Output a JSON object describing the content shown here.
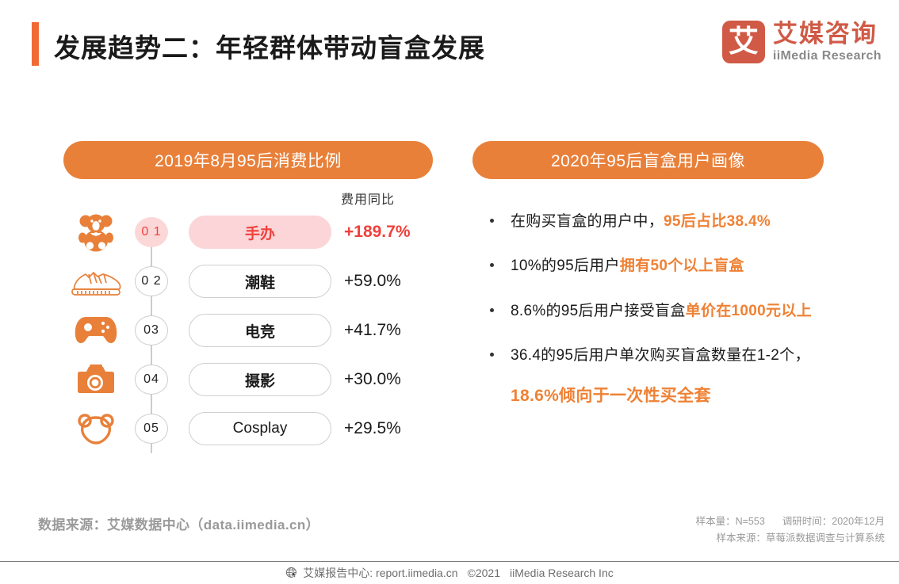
{
  "header": {
    "title": "发展趋势二：年轻群体带动盲盒发展",
    "accent_color": "#f06a35",
    "logo": {
      "mark": "艾",
      "cn": "艾媒咨询",
      "en": "iiMedia Research",
      "color": "#d05a46"
    }
  },
  "left_panel": {
    "heading": "2019年8月95后消费比例",
    "column_label": "费用同比",
    "rows": [
      {
        "rank": "0 1",
        "icon": "teddy-bear-icon",
        "label": "手办",
        "growth": "+189.7%",
        "highlight": true
      },
      {
        "rank": "0 2",
        "icon": "sneaker-icon",
        "label": "潮鞋",
        "growth": "+59.0%",
        "highlight": false
      },
      {
        "rank": "03",
        "icon": "gamepad-icon",
        "label": "电竞",
        "growth": "+41.7%",
        "highlight": false
      },
      {
        "rank": "04",
        "icon": "camera-icon",
        "label": "摄影",
        "growth": "+30.0%",
        "highlight": false
      },
      {
        "rank": "05",
        "icon": "bear-mask-icon",
        "label": "Cosplay",
        "growth": "+29.5%",
        "highlight": false
      }
    ]
  },
  "right_panel": {
    "heading": "2020年95后盲盒用户画像",
    "bullets": [
      {
        "plain_1": "在购买盲盒的用户中，",
        "accent_1": "95后占比38.4%"
      },
      {
        "plain_1": "10%的95后用户",
        "accent_1": "拥有50个以上盲盒"
      },
      {
        "plain_1": "8.6%的95后用户接受盲盒",
        "accent_1": "单价在1000元以上"
      },
      {
        "plain_1": "36.4的95后用户单次购买盲盒数量在1-2个，",
        "accent_2": "18.6%倾向于一次性买全套"
      }
    ],
    "accent_color": "#ef8134"
  },
  "footer": {
    "source_left": "数据来源：艾媒数据中心（data.iimedia.cn）",
    "sample_size_label": "样本量：N=553",
    "survey_time_label": "调研时间：2020年12月",
    "sample_source_label": "样本来源：草莓派数据调查与计算系统",
    "bar_report_center": "艾媒报告中心: report.iimedia.cn",
    "bar_copyright": "©2021",
    "bar_company": "iiMedia Research Inc"
  },
  "chart_data": {
    "type": "bar",
    "title": "2019年8月95后消费比例",
    "xlabel": "",
    "ylabel": "费用同比",
    "categories": [
      "手办",
      "潮鞋",
      "电竞",
      "摄影",
      "Cosplay"
    ],
    "values": [
      189.7,
      59.0,
      41.7,
      30.0,
      29.5
    ],
    "value_labels": [
      "+189.7%",
      "+59.0%",
      "+41.7%",
      "+30.0%",
      "+29.5%"
    ],
    "ranks": [
      "01",
      "02",
      "03",
      "04",
      "05"
    ],
    "grid": false,
    "legend": "none"
  }
}
